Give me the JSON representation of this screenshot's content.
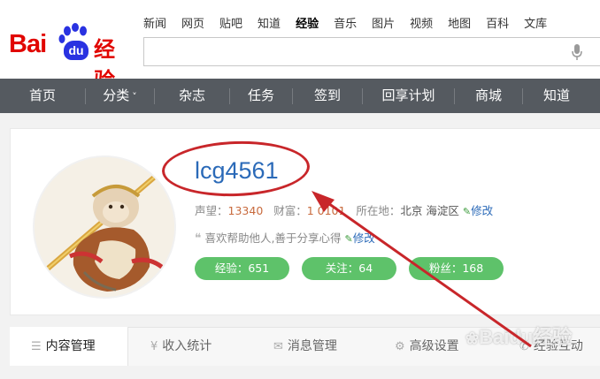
{
  "logo": {
    "bai": "Bai",
    "du": "du",
    "brand_cn": "经验"
  },
  "topnav": [
    "新闻",
    "网页",
    "贴吧",
    "知道",
    "经验",
    "音乐",
    "图片",
    "视频",
    "地图",
    "百科",
    "文库"
  ],
  "topnav_active": "经验",
  "search": {
    "value": "",
    "placeholder": ""
  },
  "mainnav": [
    "首页",
    "分类",
    "杂志",
    "任务",
    "签到",
    "回享计划",
    "商城",
    "知道"
  ],
  "mainnav_dropdown_marker": "˅",
  "profile": {
    "username": "lcg4561",
    "reputation_label": "声望：",
    "reputation_value": "13340",
    "wealth_label": "财富：",
    "wealth_value": "1 0101",
    "location_label": "所在地：",
    "location_value": "北京 海淀区",
    "edit_label": "修改",
    "motto": "喜欢帮助他人,善于分享心得",
    "motto_edit_label": "修改"
  },
  "badges": {
    "experience": "经验：651",
    "following": "关注：64",
    "fans": "粉丝：168"
  },
  "tabs": [
    "内容管理",
    "收入统计",
    "消息管理",
    "高级设置",
    "经验互动"
  ],
  "tab_icons": [
    "list-icon",
    "yen-icon",
    "mail-icon",
    "gear-icon",
    "chat-icon"
  ],
  "watermark": "Baidu经验",
  "colors": {
    "brand_red": "#e10601",
    "brand_blue": "#2932e1",
    "nav_bg": "#555a60",
    "username_blue": "#2b6ab8",
    "badge_green": "#5ec26a",
    "annotation_red": "#c8262a"
  }
}
